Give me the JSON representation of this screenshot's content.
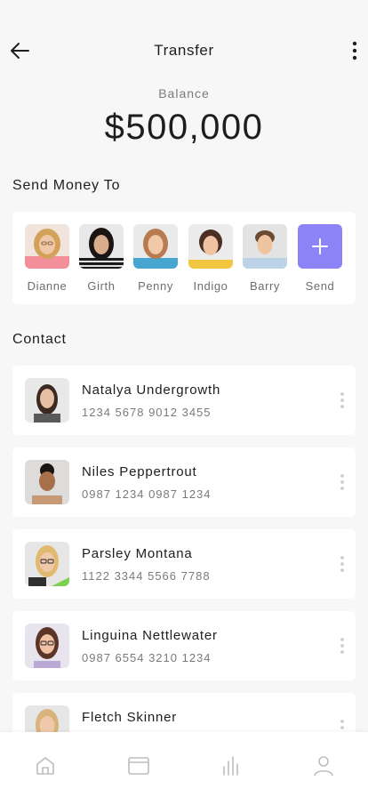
{
  "header": {
    "title": "Transfer",
    "back_icon": "arrow-left-icon",
    "menu_icon": "more-vertical-icon"
  },
  "balance": {
    "label": "Balance",
    "value": "$500,000"
  },
  "send_money": {
    "title": "Send Money To",
    "recipients": [
      {
        "name": "Dianne"
      },
      {
        "name": "Girth"
      },
      {
        "name": "Penny"
      },
      {
        "name": "Indigo"
      },
      {
        "name": "Barry"
      }
    ],
    "send_label": "Send",
    "send_icon": "plus-icon"
  },
  "contacts": {
    "title": "Contact",
    "items": [
      {
        "name": "Natalya Undergrowth",
        "number": "1234 5678 9012 3455"
      },
      {
        "name": "Niles Peppertrout",
        "number": "0987 1234 0987 1234"
      },
      {
        "name": "Parsley Montana",
        "number": "1122 3344 5566 7788"
      },
      {
        "name": "Linguina Nettlewater",
        "number": "0987 6554 3210 1234"
      },
      {
        "name": "Fletch Skinner",
        "number": ""
      }
    ]
  },
  "tabbar": {
    "tabs": [
      "home-icon",
      "card-icon",
      "chart-icon",
      "user-icon"
    ]
  },
  "colors": {
    "accent": "#8b83f6",
    "background": "#f7f7f7",
    "card": "#ffffff"
  }
}
